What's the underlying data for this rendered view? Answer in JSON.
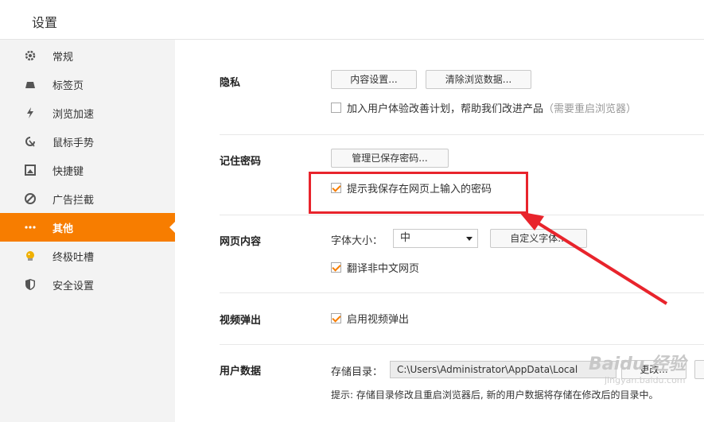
{
  "header": {
    "title": "设置"
  },
  "sidebar": {
    "items": [
      {
        "label": "常规",
        "icon": "gear-icon"
      },
      {
        "label": "标签页",
        "icon": "tab-icon"
      },
      {
        "label": "浏览加速",
        "icon": "lightning-icon"
      },
      {
        "label": "鼠标手势",
        "icon": "cursor-gesture-icon"
      },
      {
        "label": "快捷键",
        "icon": "keyboard-shortcut-icon"
      },
      {
        "label": "广告拦截",
        "icon": "block-icon"
      },
      {
        "label": "其他",
        "icon": "more-dots-icon",
        "active": true
      },
      {
        "label": "终极吐槽",
        "icon": "feedback-icon"
      },
      {
        "label": "安全设置",
        "icon": "shield-icon"
      }
    ]
  },
  "privacy": {
    "label": "隐私",
    "content_settings_btn": "内容设置...",
    "clear_data_btn": "清除浏览数据...",
    "ux_plan_text": "加入用户体验改善计划，帮助我们改进产品",
    "ux_plan_note": "（需要重启浏览器）",
    "ux_plan_checked": false
  },
  "passwords": {
    "label": "记住密码",
    "manage_btn": "管理已保存密码...",
    "prompt_text": "提示我保存在网页上输入的密码",
    "prompt_checked": true
  },
  "webcontent": {
    "label": "网页内容",
    "font_size_label": "字体大小：",
    "font_size_value": "中",
    "custom_font_btn": "自定义字体...",
    "translate_text": "翻译非中文网页",
    "translate_checked": true
  },
  "video": {
    "label": "视频弹出",
    "enable_text": "启用视频弹出",
    "enable_checked": true
  },
  "userdata": {
    "label": "用户数据",
    "storage_label": "存储目录：",
    "storage_path": "C:\\Users\\Administrator\\AppData\\Local",
    "change_btn": "更改...",
    "hint": "提示: 存储目录修改且重启浏览器后, 新的用户数据将存储在修改后的目录中。"
  },
  "watermark": {
    "brand": "Baidu 经验",
    "sub": "jingyan.baidu.com"
  },
  "colors": {
    "accent": "#f77d00",
    "annotation_red": "#e8242c"
  }
}
